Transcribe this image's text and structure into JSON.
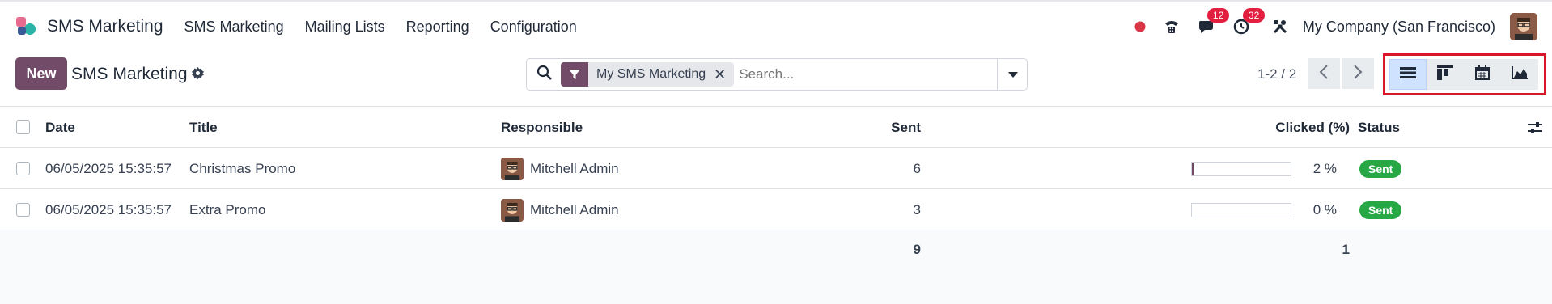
{
  "app": {
    "brand": "SMS Marketing",
    "menu": [
      "SMS Marketing",
      "Mailing Lists",
      "Reporting",
      "Configuration"
    ],
    "messages_badge": "12",
    "activities_badge": "32",
    "company": "My Company (San Francisco)"
  },
  "control": {
    "new_label": "New",
    "title": "SMS Marketing",
    "facet_label": "My SMS Marketing",
    "search_placeholder": "Search...",
    "pager": "1-2 / 2"
  },
  "views": [
    "list-view",
    "kanban-view",
    "calendar-view",
    "graph-view"
  ],
  "table": {
    "columns": {
      "date": "Date",
      "title": "Title",
      "responsible": "Responsible",
      "sent": "Sent",
      "clicked": "Clicked (%)",
      "status": "Status"
    },
    "rows": [
      {
        "date": "06/05/2025 15:35:57",
        "title": "Christmas Promo",
        "responsible": "Mitchell Admin",
        "sent": "6",
        "clicked_text": "2 %",
        "clicked_fraction": 0.02,
        "status": "Sent"
      },
      {
        "date": "06/05/2025 15:35:57",
        "title": "Extra Promo",
        "responsible": "Mitchell Admin",
        "sent": "3",
        "clicked_text": "0 %",
        "clicked_fraction": 0.0,
        "status": "Sent"
      }
    ],
    "totals": {
      "sent": "9",
      "clicked": "1"
    }
  },
  "colors": {
    "brand": "#714b67",
    "status_sent": "#28a745",
    "badge": "#e21f3f",
    "highlight": "#d9162b"
  }
}
